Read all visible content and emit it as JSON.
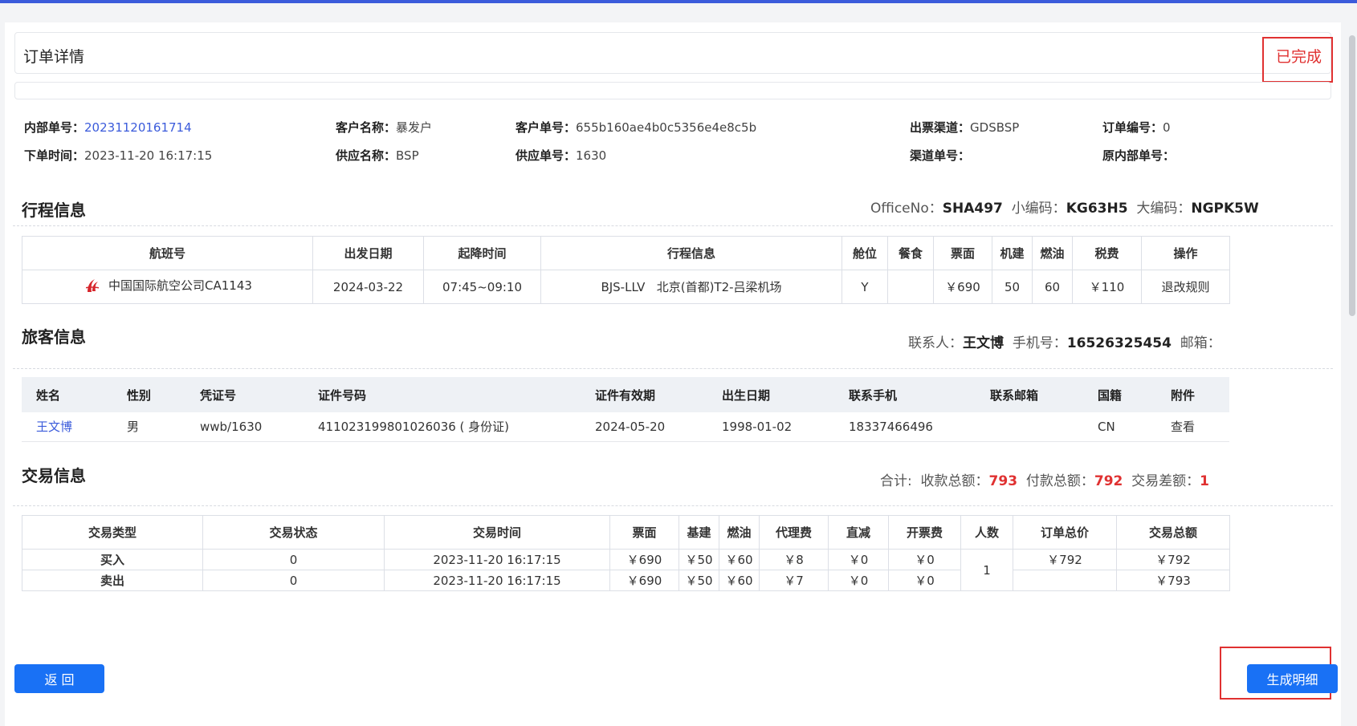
{
  "header": {
    "title": "订单详情",
    "status": "已完成"
  },
  "order_info": {
    "row1": [
      {
        "label": "内部单号：",
        "value": "20231120161714",
        "link": true
      },
      {
        "label": "客户名称：",
        "value": "暴发户"
      },
      {
        "label": "客户单号：",
        "value": "655b160ae4b0c5356e4e8c5b"
      },
      {
        "label": "出票渠道：",
        "value": "GDSBSP"
      },
      {
        "label": "订单编号：",
        "value": "0"
      }
    ],
    "row2": [
      {
        "label": "下单时间：",
        "value": "2023-11-20 16:17:15"
      },
      {
        "label": "供应名称：",
        "value": "BSP"
      },
      {
        "label": "供应单号：",
        "value": "1630"
      },
      {
        "label": "渠道单号：",
        "value": ""
      },
      {
        "label": "原内部单号：",
        "value": ""
      }
    ]
  },
  "itinerary": {
    "title": "行程信息",
    "office_label": "OfficeNo：",
    "office_value": "SHA497",
    "small_code_label": "小编码：",
    "small_code_value": "KG63H5",
    "big_code_label": "大编码：",
    "big_code_value": "NGPK5W",
    "columns": [
      "航班号",
      "出发日期",
      "起降时间",
      "行程信息",
      "舱位",
      "餐食",
      "票面",
      "机建",
      "燃油",
      "税费",
      "操作"
    ],
    "row": {
      "airline_icon": "air-china-logo",
      "flight": "中国国际航空公司CA1143",
      "date": "2024-03-22",
      "time": "07:45~09:10",
      "route": "BJS-LLV   北京(首都)T2-吕梁机场",
      "cabin": "Y",
      "meal": "",
      "fare": "￥690",
      "airport_fee": "50",
      "fuel": "60",
      "tax": "￥110",
      "action": "退改规则"
    }
  },
  "passenger": {
    "title": "旅客信息",
    "contact_label": "联系人：",
    "contact_value": "王文博",
    "phone_label": "手机号：",
    "phone_value": "16526325454",
    "email_label": "邮箱：",
    "columns": [
      "姓名",
      "性别",
      "凭证号",
      "证件号码",
      "证件有效期",
      "出生日期",
      "联系手机",
      "联系邮箱",
      "国籍",
      "附件"
    ],
    "row": {
      "name": "王文博",
      "gender": "男",
      "voucher": "wwb/1630",
      "id_no": "411023199801026036 ( 身份证)",
      "expiry": "2024-05-20",
      "birth": "1998-01-02",
      "phone": "18337466496",
      "email": "",
      "nationality": "CN",
      "attachment": "查看"
    }
  },
  "trade": {
    "title": "交易信息",
    "total_label": "合计:",
    "receive_label": "收款总额：",
    "receive_value": "793",
    "pay_label": "付款总额：",
    "pay_value": "792",
    "diff_label": "交易差额：",
    "diff_value": "1",
    "columns": [
      "交易类型",
      "交易状态",
      "交易时间",
      "票面",
      "基建",
      "燃油",
      "代理费",
      "直减",
      "开票费",
      "人数",
      "订单总价",
      "交易总额"
    ],
    "rows": [
      {
        "type": "买入",
        "status": "0",
        "time": "2023-11-20 16:17:15",
        "fare": "￥690",
        "base": "￥50",
        "fuel": "￥60",
        "agent": "￥8",
        "discount": "￥0",
        "ticket_fee": "￥0",
        "order_total": "￥792",
        "trade_total": "￥792"
      },
      {
        "type": "卖出",
        "status": "0",
        "time": "2023-11-20 16:17:15",
        "fare": "￥690",
        "base": "￥50",
        "fuel": "￥60",
        "agent": "￥7",
        "discount": "￥0",
        "ticket_fee": "￥0",
        "order_total": "",
        "trade_total": "￥793"
      }
    ],
    "people": "1"
  },
  "buttons": {
    "back": "返 回",
    "generate": "生成明细"
  },
  "colors": {
    "primary": "#1971f5",
    "danger": "#e03131",
    "link": "#3b5bdb"
  }
}
